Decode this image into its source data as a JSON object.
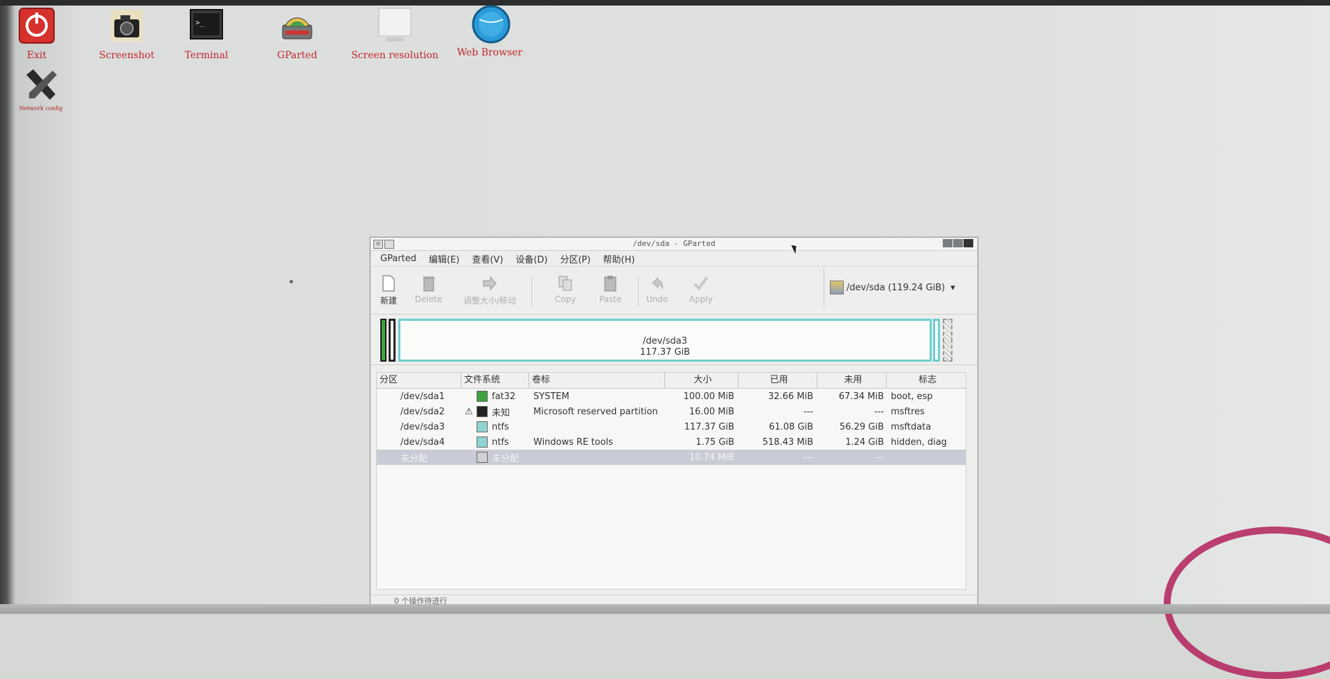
{
  "desktop": {
    "icons": [
      {
        "label": "Exit",
        "icon": "power-icon"
      },
      {
        "label": "Screenshot",
        "icon": "camera-icon"
      },
      {
        "label": "Terminal",
        "icon": "terminal-icon"
      },
      {
        "label": "GParted",
        "icon": "disk-icon"
      },
      {
        "label": "Screen resolution",
        "icon": "monitor-icon"
      },
      {
        "label": "Web Browser",
        "icon": "globe-icon"
      },
      {
        "label": "Network config",
        "icon": "tools-icon"
      }
    ]
  },
  "window": {
    "title": "/dev/sda - GParted",
    "menu": [
      "GParted",
      "编辑(E)",
      "查看(V)",
      "设备(D)",
      "分区(P)",
      "帮助(H)"
    ],
    "toolbar": {
      "new": "新建",
      "delete": "Delete",
      "resize": "调整大小/移动",
      "copy": "Copy",
      "paste": "Paste",
      "undo": "Undo",
      "apply": "Apply"
    },
    "device_selector": "/dev/sda  (119.24 GiB)",
    "diskmap": {
      "name": "/dev/sda3",
      "size": "117.37 GiB"
    },
    "columns": [
      "分区",
      "文件系统",
      "卷标",
      "大小",
      "已用",
      "未用",
      "标志"
    ],
    "rows": [
      {
        "partition": "/dev/sda1",
        "warn": "",
        "fs": "fat32",
        "fs_color": "#3fa23f",
        "label": "SYSTEM",
        "size": "100.00 MiB",
        "used": "32.66 MiB",
        "unused": "67.34 MiB",
        "flags": "boot, esp"
      },
      {
        "partition": "/dev/sda2",
        "warn": "⚠",
        "fs": "未知",
        "fs_color": "#222222",
        "label": "Microsoft reserved partition",
        "size": "16.00 MiB",
        "used": "---",
        "unused": "---",
        "flags": "msftres"
      },
      {
        "partition": "/dev/sda3",
        "warn": "",
        "fs": "ntfs",
        "fs_color": "#8fd3d3",
        "label": "",
        "size": "117.37 GiB",
        "used": "61.08 GiB",
        "unused": "56.29 GiB",
        "flags": "msftdata"
      },
      {
        "partition": "/dev/sda4",
        "warn": "",
        "fs": "ntfs",
        "fs_color": "#8fd3d3",
        "label": "Windows RE tools",
        "size": "1.75 GiB",
        "used": "518.43 MiB",
        "unused": "1.24 GiB",
        "flags": "hidden, diag"
      },
      {
        "partition": "未分配",
        "warn": "",
        "fs": "未分配",
        "fs_color": "#d0d0d0",
        "label": "",
        "size": "10.74 MiB",
        "used": "---",
        "unused": "---",
        "flags": ""
      }
    ],
    "status": "0 个操作待进行"
  }
}
